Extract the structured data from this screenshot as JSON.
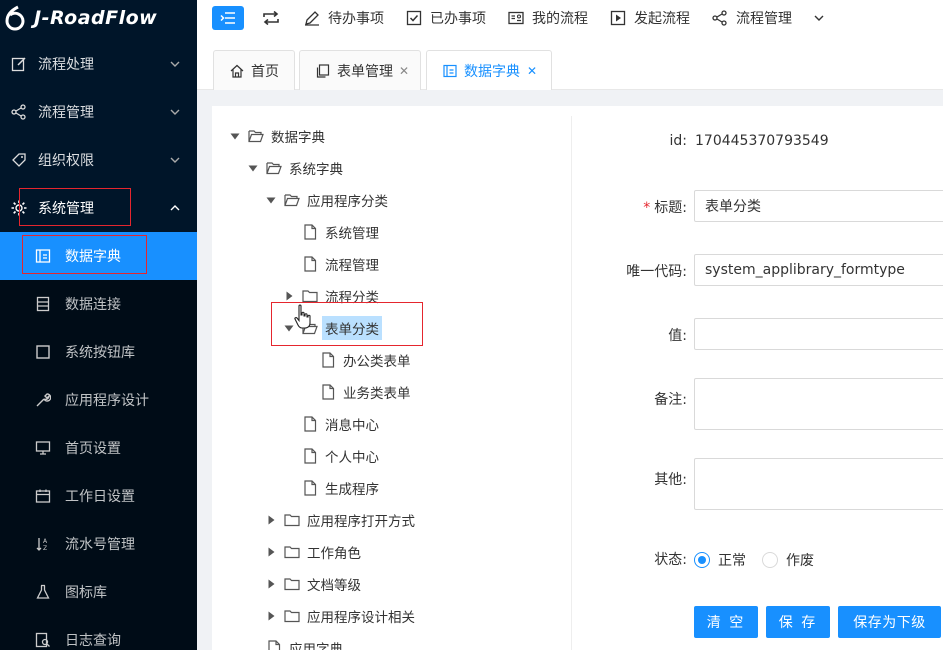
{
  "app": {
    "logo_text": "J-RoadFlow"
  },
  "sidebar": {
    "menus": [
      {
        "label": "流程处理",
        "icon": "edit-icon",
        "expanded": false
      },
      {
        "label": "流程管理",
        "icon": "share-icon",
        "expanded": false
      },
      {
        "label": "组织权限",
        "icon": "tag-icon",
        "expanded": false
      },
      {
        "label": "系统管理",
        "icon": "gear-icon",
        "expanded": true
      }
    ],
    "sub_items": [
      {
        "label": "数据字典",
        "icon": "dictionary-icon",
        "active": true
      },
      {
        "label": "数据连接",
        "icon": "database-icon",
        "active": false
      },
      {
        "label": "系统按钮库",
        "icon": "square-icon",
        "active": false
      },
      {
        "label": "应用程序设计",
        "icon": "wrench-icon",
        "active": false
      },
      {
        "label": "首页设置",
        "icon": "monitor-icon",
        "active": false
      },
      {
        "label": "工作日设置",
        "icon": "calendar-icon",
        "active": false
      },
      {
        "label": "流水号管理",
        "icon": "sort-icon",
        "active": false
      },
      {
        "label": "图标库",
        "icon": "flask-icon",
        "active": false
      },
      {
        "label": "日志查询",
        "icon": "log-search-icon",
        "active": false
      }
    ]
  },
  "topbar": {
    "nav": [
      {
        "label": "待办事项",
        "icon": "pen-icon"
      },
      {
        "label": "已办事项",
        "icon": "checkbox-icon"
      },
      {
        "label": "我的流程",
        "icon": "id-card-icon"
      },
      {
        "label": "发起流程",
        "icon": "play-icon"
      },
      {
        "label": "流程管理",
        "icon": "share-icon"
      }
    ]
  },
  "tabs": [
    {
      "label": "首页",
      "icon": "home-icon",
      "closable": false,
      "active": false
    },
    {
      "label": "表单管理",
      "icon": "copy-icon",
      "closable": true,
      "active": false
    },
    {
      "label": "数据字典",
      "icon": "dictionary-icon",
      "closable": true,
      "active": true
    }
  ],
  "tree": [
    {
      "label": "数据字典",
      "toggle": "expanded",
      "icon": "folder-open-icon"
    },
    {
      "label": "系统字典",
      "toggle": "expanded",
      "icon": "folder-open-icon"
    },
    {
      "label": "应用程序分类",
      "toggle": "expanded",
      "icon": "folder-open-icon"
    },
    {
      "label": "系统管理",
      "toggle": "none",
      "icon": "file-icon"
    },
    {
      "label": "流程管理",
      "toggle": "none",
      "icon": "file-icon"
    },
    {
      "label": "流程分类",
      "toggle": "collapsed",
      "icon": "folder-icon"
    },
    {
      "label": "表单分类",
      "toggle": "expanded",
      "icon": "folder-open-icon",
      "selected": true
    },
    {
      "label": "办公类表单",
      "toggle": "none",
      "icon": "file-icon"
    },
    {
      "label": "业务类表单",
      "toggle": "none",
      "icon": "file-icon"
    },
    {
      "label": "消息中心",
      "toggle": "none",
      "icon": "file-icon"
    },
    {
      "label": "个人中心",
      "toggle": "none",
      "icon": "file-icon"
    },
    {
      "label": "生成程序",
      "toggle": "none",
      "icon": "file-icon"
    },
    {
      "label": "应用程序打开方式",
      "toggle": "collapsed",
      "icon": "folder-icon"
    },
    {
      "label": "工作角色",
      "toggle": "collapsed",
      "icon": "folder-icon"
    },
    {
      "label": "文档等级",
      "toggle": "collapsed",
      "icon": "folder-icon"
    },
    {
      "label": "应用程序设计相关",
      "toggle": "collapsed",
      "icon": "folder-icon"
    },
    {
      "label": "应用字典",
      "toggle": "none",
      "icon": "file-icon"
    }
  ],
  "form": {
    "id_label": "id:",
    "id_value": "170445370793549",
    "required_mark": "*",
    "title_label": "标题:",
    "title_value": "表单分类",
    "code_label": "唯一代码:",
    "code_value": "system_applibrary_formtype",
    "value_label": "值:",
    "value_value": "",
    "note_label": "备注:",
    "other_label": "其他:",
    "status_label": "状态:",
    "status_options": [
      {
        "label": "正常",
        "checked": true
      },
      {
        "label": "作废",
        "checked": false
      }
    ]
  },
  "buttons": {
    "clear": "清 空",
    "save": "保 存",
    "save_child": "保存为下级"
  },
  "colors": {
    "sidebar_bg": "#001529",
    "primary": "#1890ff",
    "highlight_box": "#e5262e"
  }
}
